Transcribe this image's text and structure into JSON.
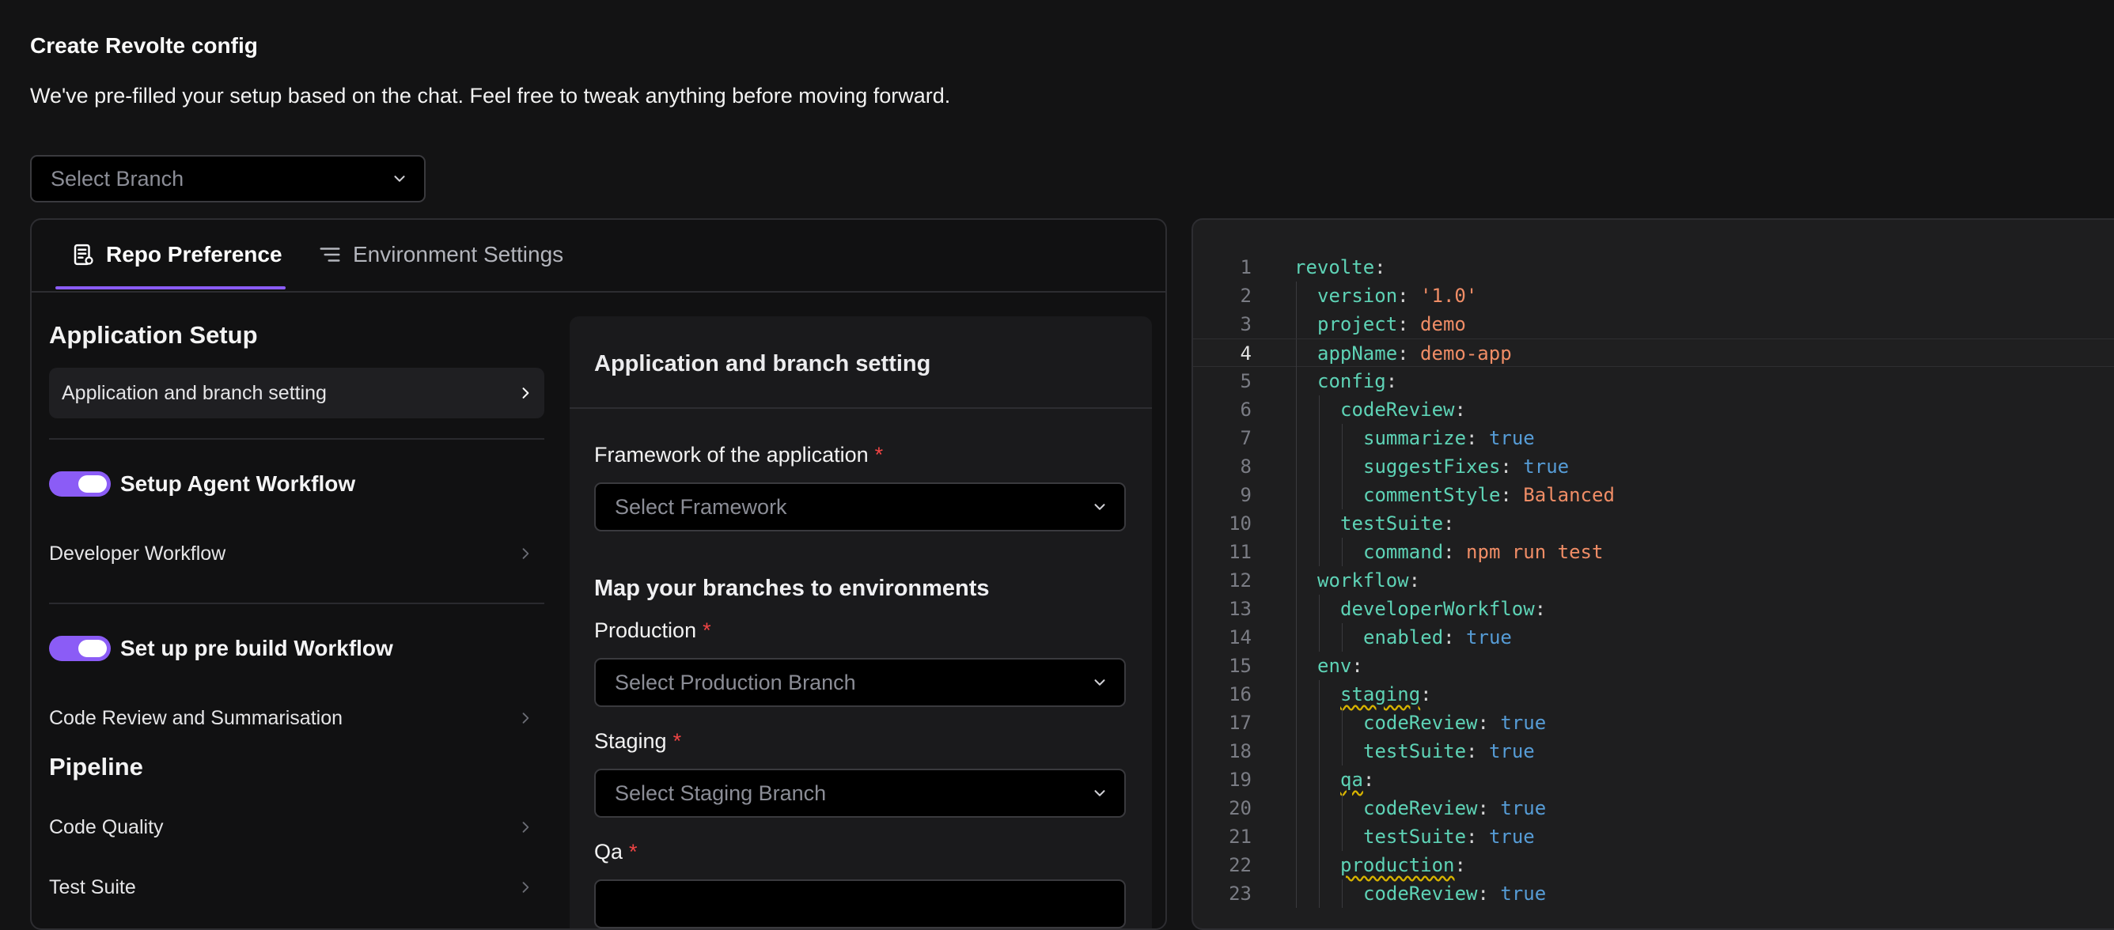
{
  "header": {
    "title": "Create Revolte config",
    "subtitle": "We've pre-filled your setup based on the chat. Feel free to tweak anything before moving forward."
  },
  "branch_select": {
    "placeholder": "Select Branch"
  },
  "tabs": [
    {
      "label": "Repo Preference",
      "icon": "document-list-icon",
      "active": true
    },
    {
      "label": "Environment Settings",
      "icon": "lines-icon",
      "active": false
    }
  ],
  "nav": {
    "application_setup": "Application Setup",
    "application_branch_item": "Application and branch setting",
    "agent_workflow_toggle": "Setup Agent Workflow",
    "developer_workflow": "Developer Workflow",
    "prebuild_toggle": "Set up pre build Workflow",
    "code_review": "Code Review and Summarisation",
    "pipeline": "Pipeline",
    "code_quality": "Code Quality",
    "test_suite": "Test Suite"
  },
  "form": {
    "header": "Application and branch setting",
    "framework_label": "Framework of the application",
    "framework_placeholder": "Select Framework",
    "map_title": "Map your branches to environments",
    "production_label": "Production",
    "production_placeholder": "Select Production Branch",
    "staging_label": "Staging",
    "staging_placeholder": "Select Staging Branch",
    "qa_label": "Qa",
    "required_mark": "*"
  },
  "editor": {
    "current_line": 4,
    "lines": [
      {
        "n": "1",
        "indent": 0,
        "key": "revolte",
        "value": "",
        "vtype": ""
      },
      {
        "n": "2",
        "indent": 1,
        "key": "version",
        "value": "'1.0'",
        "vtype": "s"
      },
      {
        "n": "3",
        "indent": 1,
        "key": "project",
        "value": "demo",
        "vtype": "s"
      },
      {
        "n": "4",
        "indent": 1,
        "key": "appName",
        "value": "demo-app",
        "vtype": "s"
      },
      {
        "n": "5",
        "indent": 1,
        "key": "config",
        "value": "",
        "vtype": ""
      },
      {
        "n": "6",
        "indent": 2,
        "key": "codeReview",
        "value": "",
        "vtype": ""
      },
      {
        "n": "7",
        "indent": 3,
        "key": "summarize",
        "value": "true",
        "vtype": "b"
      },
      {
        "n": "8",
        "indent": 3,
        "key": "suggestFixes",
        "value": "true",
        "vtype": "b"
      },
      {
        "n": "9",
        "indent": 3,
        "key": "commentStyle",
        "value": "Balanced",
        "vtype": "s"
      },
      {
        "n": "10",
        "indent": 2,
        "key": "testSuite",
        "value": "",
        "vtype": ""
      },
      {
        "n": "11",
        "indent": 3,
        "key": "command",
        "value": "npm run test",
        "vtype": "s"
      },
      {
        "n": "12",
        "indent": 1,
        "key": "workflow",
        "value": "",
        "vtype": ""
      },
      {
        "n": "13",
        "indent": 2,
        "key": "developerWorkflow",
        "value": "",
        "vtype": ""
      },
      {
        "n": "14",
        "indent": 3,
        "key": "enabled",
        "value": "true",
        "vtype": "b"
      },
      {
        "n": "15",
        "indent": 1,
        "key": "env",
        "value": "",
        "vtype": ""
      },
      {
        "n": "16",
        "indent": 2,
        "key": "staging",
        "value": "",
        "vtype": "",
        "warn": true
      },
      {
        "n": "17",
        "indent": 3,
        "key": "codeReview",
        "value": "true",
        "vtype": "b"
      },
      {
        "n": "18",
        "indent": 3,
        "key": "testSuite",
        "value": "true",
        "vtype": "b"
      },
      {
        "n": "19",
        "indent": 2,
        "key": "qa",
        "value": "",
        "vtype": "",
        "warn": true
      },
      {
        "n": "20",
        "indent": 3,
        "key": "codeReview",
        "value": "true",
        "vtype": "b"
      },
      {
        "n": "21",
        "indent": 3,
        "key": "testSuite",
        "value": "true",
        "vtype": "b"
      },
      {
        "n": "22",
        "indent": 2,
        "key": "production",
        "value": "",
        "vtype": "",
        "warn": true
      },
      {
        "n": "23",
        "indent": 3,
        "key": "codeReview",
        "value": "true",
        "vtype": "b"
      }
    ]
  },
  "colors": {
    "accent": "#8b5cf6",
    "required": "#ef4444",
    "yaml_key": "#5ed3b6",
    "yaml_string": "#f08d66",
    "yaml_bool": "#569cd6"
  }
}
